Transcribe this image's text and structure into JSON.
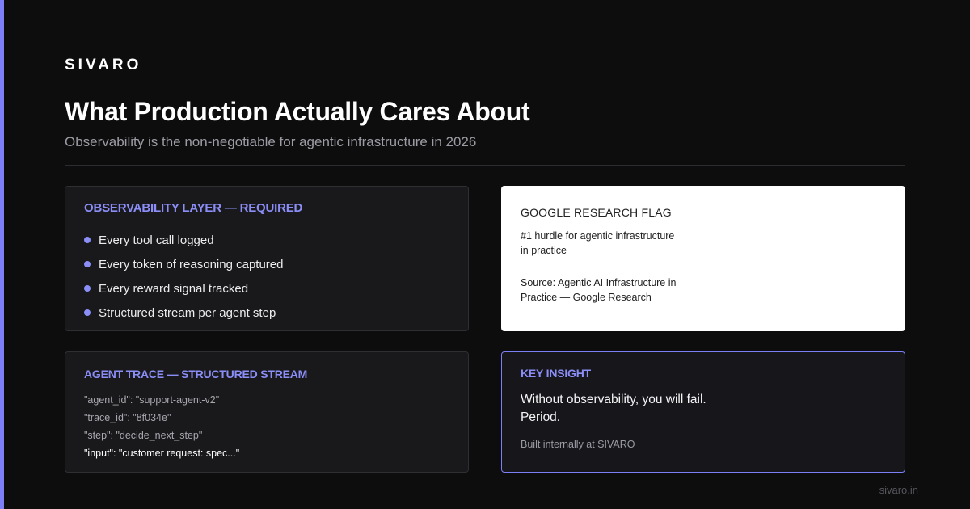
{
  "brand": "SIVARO",
  "title": "What Production Actually Cares About",
  "subtitle": "Observability is the non-negotiable for agentic infrastructure in 2026",
  "observability_card": {
    "heading": "OBSERVABILITY LAYER — REQUIRED",
    "items": [
      "Every tool call logged",
      "Every token of reasoning captured",
      "Every reward signal tracked",
      "Structured stream per agent step"
    ]
  },
  "google_card": {
    "heading": "GOOGLE RESEARCH FLAG",
    "hurdle": "#1 hurdle for agentic infrastructure in practice",
    "source": "Source: Agentic AI Infrastructure in Practice — Google Research"
  },
  "trace_card": {
    "heading": "AGENT TRACE — STRUCTURED STREAM",
    "lines": [
      "\"agent_id\": \"support-agent-v2\"",
      "\"trace_id\": \"8f034e\"",
      "\"step\": \"decide_next_step\"",
      "\"input\": \"customer request: spec...\""
    ]
  },
  "insight_card": {
    "heading": "KEY INSIGHT",
    "text": "Without observability, you will fail. Period.",
    "footnote": "Built internally at SIVARO"
  },
  "footer_url": "sivaro.in",
  "colors": {
    "accent": "#7c7ff5",
    "heading_accent": "#8b8ef7",
    "background": "#0d0d0e",
    "card": "#19191c"
  }
}
